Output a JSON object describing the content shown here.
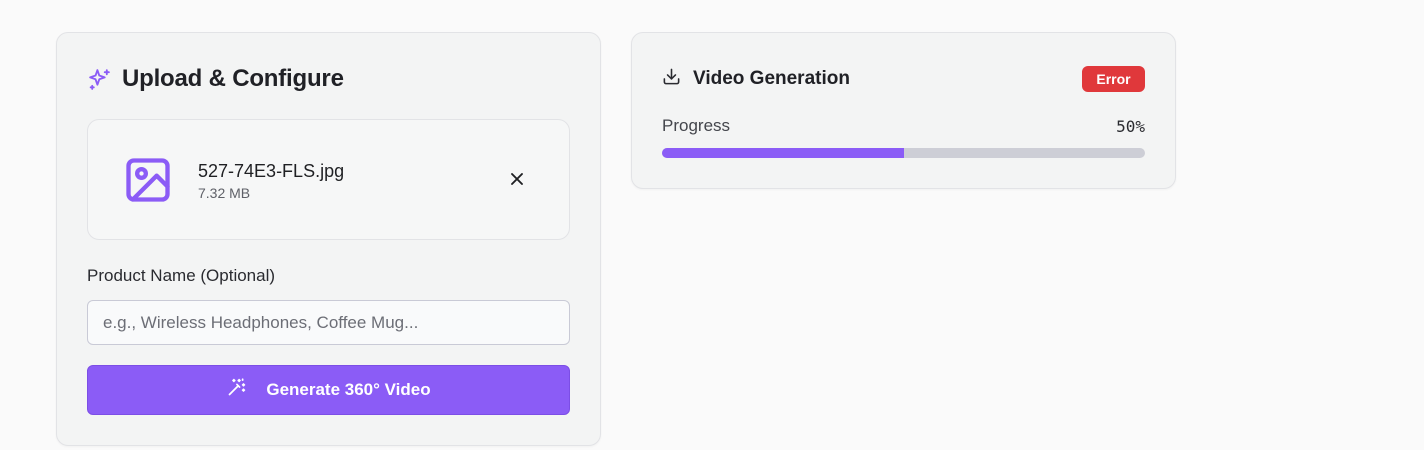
{
  "upload_panel": {
    "title": "Upload & Configure",
    "title_icon": "sparkles-icon",
    "file": {
      "name": "527-74E3-FLS.jpg",
      "size": "7.32 MB",
      "icon": "image-icon"
    },
    "product_name": {
      "label": "Product Name (Optional)",
      "value": "",
      "placeholder": "e.g., Wireless Headphones, Coffee Mug..."
    },
    "generate_button": {
      "label": "Generate 360° Video",
      "icon": "magic-wand-icon"
    }
  },
  "video_panel": {
    "title": "Video Generation",
    "title_icon": "download-icon",
    "status_badge": "Error",
    "progress_label": "Progress",
    "progress_text": "50%",
    "progress_value": 0.5
  },
  "colors": {
    "accent": "#8b5cf6",
    "error": "#e0383b",
    "track": "#cdced6",
    "card_bg": "#f3f4f4"
  }
}
